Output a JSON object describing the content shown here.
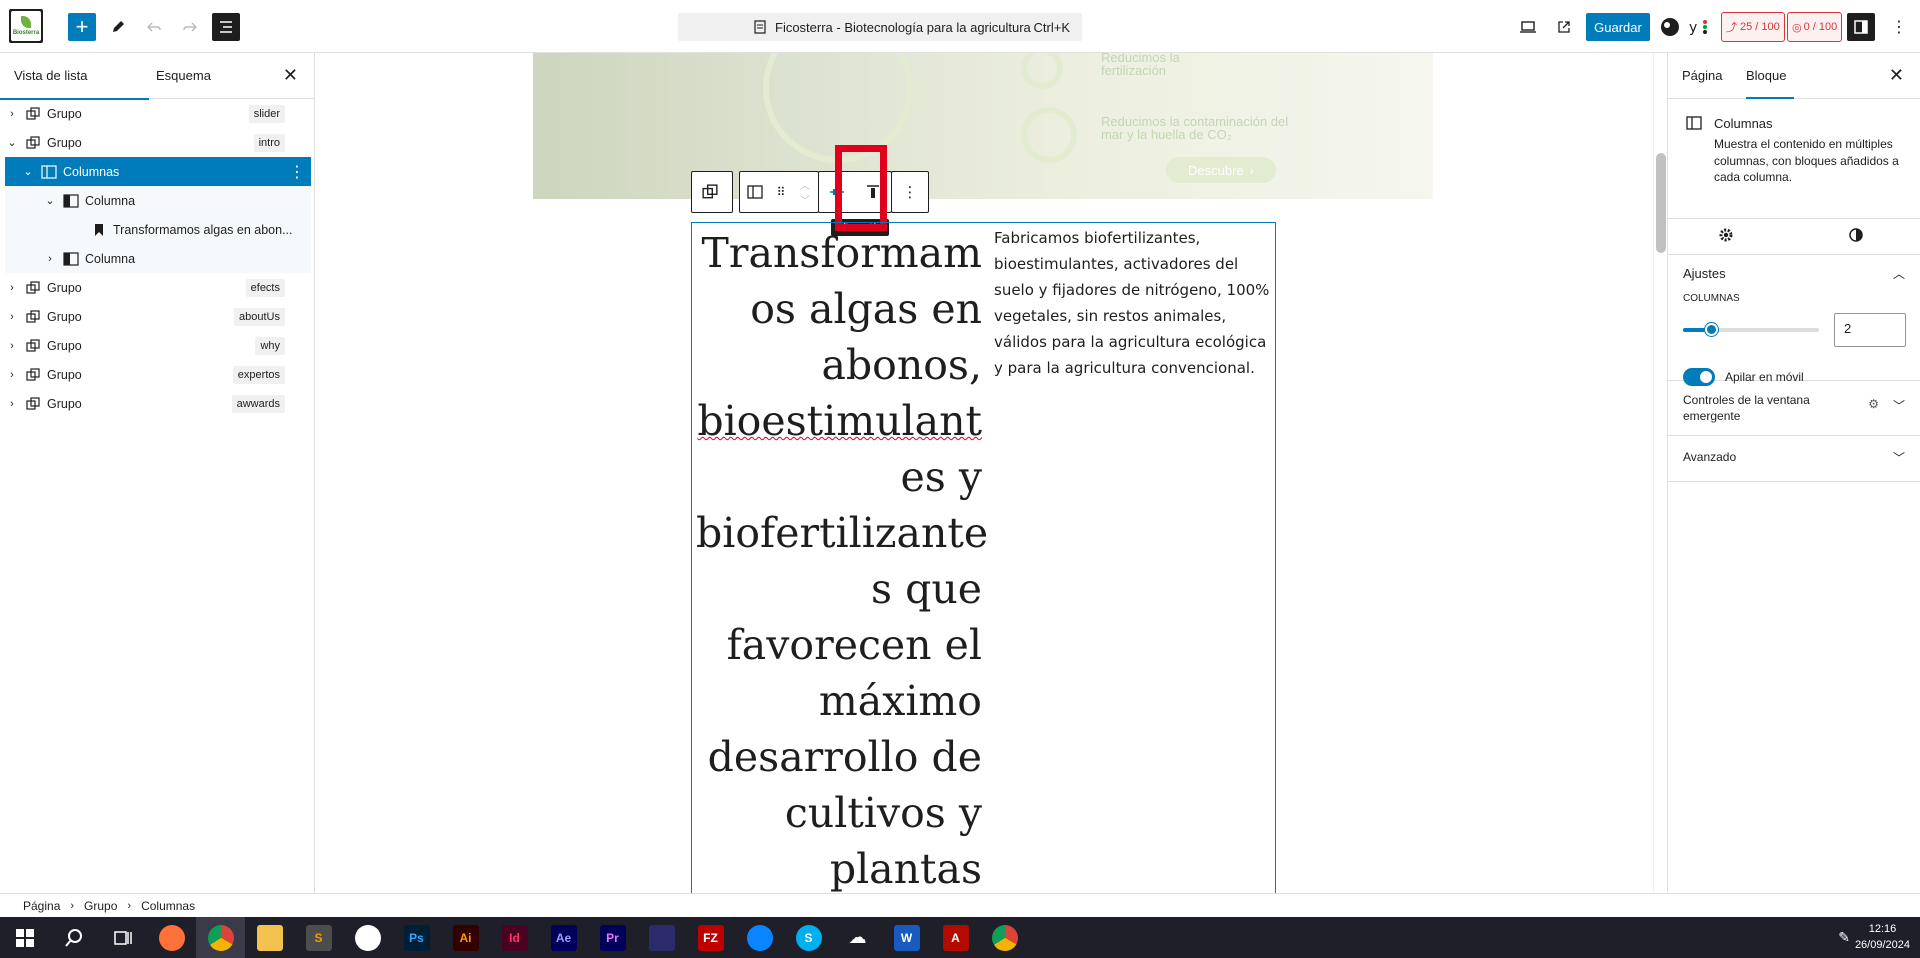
{
  "topbar": {
    "logo_text": "Biosterra",
    "command": "Ficosterra - Biotecnología para la agricultura",
    "command_shortcut": "Ctrl+K",
    "save_label": "Guardar",
    "seo_score": "25 / 100",
    "read_score": "0 / 100"
  },
  "left_panel": {
    "tab_list": "Vista de lista",
    "tab_outline": "Esquema",
    "items": [
      {
        "label": "Grupo",
        "tag": "slider"
      },
      {
        "label": "Grupo",
        "tag": "intro"
      },
      {
        "label": "Columnas"
      },
      {
        "label": "Columna"
      },
      {
        "label": "Transformamos algas en abon..."
      },
      {
        "label": "Columna"
      },
      {
        "label": "Grupo",
        "tag": "efects"
      },
      {
        "label": "Grupo",
        "tag": "aboutUs"
      },
      {
        "label": "Grupo",
        "tag": "why"
      },
      {
        "label": "Grupo",
        "tag": "expertos"
      },
      {
        "label": "Grupo",
        "tag": "awwards"
      }
    ]
  },
  "canvas": {
    "hero_texts": [
      "Reducimos la fertilización",
      "Reducimos la contaminación del mar y la huella de CO₂",
      "Descubre"
    ],
    "tooltip": "Alineación",
    "heading_lines": [
      "Transformam",
      "os algas en",
      "abonos,",
      "bioestimulant",
      "es y",
      "biofertilizante",
      "s que",
      "favorecen el",
      "máximo",
      "desarrollo de",
      "cultivos y",
      "plantas"
    ],
    "paragraph": "Fabricamos biofertilizantes, bioestimulantes, activadores del suelo y fijadores de nitrógeno, 100% vegetales, sin restos animales, válidos para la agricultura ecológica y para la agricultura convencional."
  },
  "right_panel": {
    "tab_page": "Página",
    "tab_block": "Bloque",
    "block_title": "Columnas",
    "block_desc": "Muestra el contenido en múltiples columnas, con bloques añadidos a cada columna.",
    "settings_title": "Ajustes",
    "columns_label": "COLUMNAS",
    "columns_value": "2",
    "columns_slider": 2,
    "stack_label": "Apilar en móvil",
    "popup_title": "Controles de la ventana emergente",
    "advanced_title": "Avanzado"
  },
  "breadcrumb": [
    "Página",
    "Grupo",
    "Columnas"
  ],
  "taskbar": {
    "time": "12:16",
    "date": "26/09/2024"
  },
  "colors": {
    "accent": "#007cba",
    "danger": "#d63638",
    "highlight": "#e0001b"
  }
}
